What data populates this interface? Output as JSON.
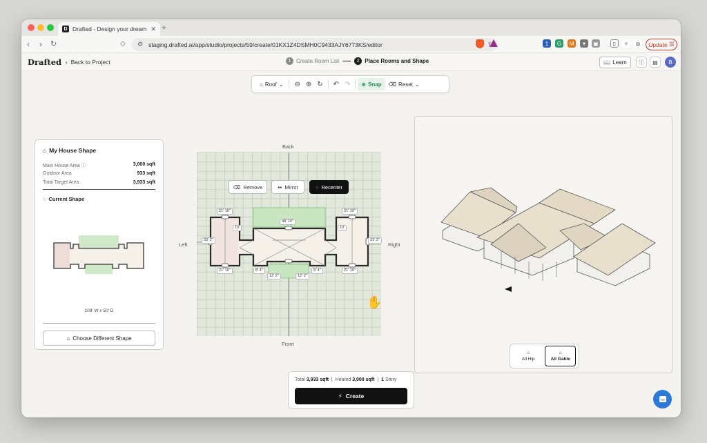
{
  "browser": {
    "tab_title": "Drafted - Design your dream h",
    "favicon_letter": "D",
    "url": "staging.drafted.ai/app/studio/projects/59/create/01KX1Z4DSMH0C9433AJY6773KS/editor",
    "update_label": "Update"
  },
  "header": {
    "logo": "Drafted",
    "back_label": "Back to Project",
    "steps": [
      {
        "num": "1",
        "label": "Create Room List"
      },
      {
        "num": "2",
        "label": "Place Rooms and Shape"
      }
    ],
    "learn_label": "Learn",
    "avatar_initial": "B"
  },
  "toolbar": {
    "roof_label": "Roof",
    "snap_label": "Snap",
    "reset_label": "Reset"
  },
  "left_panel": {
    "title": "My House Shape",
    "rows": [
      {
        "label": "Main House Area",
        "value": "3,000 sqft"
      },
      {
        "label": "Outdoor Area",
        "value": "933 sqft"
      },
      {
        "label": "Total Target Area",
        "value": "3,933 sqft"
      }
    ],
    "current_shape_label": "Current Shape",
    "dimensions": "108' W x 50' D",
    "choose_label": "Choose Different Shape"
  },
  "canvas": {
    "back": "Back",
    "front": "Front",
    "left": "Left",
    "right": "Right",
    "remove_label": "Remove",
    "mirror_label": "Mirror",
    "recenter_label": "Recenter",
    "dims": {
      "top_left": "21' 10\"",
      "top_center": "48' 10\"",
      "top_right": "21' 10\"",
      "bottom_left": "21' 10\"",
      "bottom_right": "21' 10\"",
      "left_side": "33' 2\"",
      "right_side": "33' 2\"",
      "inner_left": "10'",
      "inner_right": "10'",
      "step_left": "8' 4\"",
      "step_right": "8' 4\"",
      "porch_left": "12' 2\"",
      "porch_right": "12' 2\""
    }
  },
  "view3d": {
    "hip_label": "All Hip",
    "gable_label": "All Gable",
    "selected": "All Gable"
  },
  "summary": {
    "total_label": "Total",
    "total_value": "3,933 sqft",
    "heated_label": "Heated",
    "heated_value": "3,000 sqft",
    "story_value": "1",
    "story_label": "Story",
    "create_label": "Create"
  },
  "colors": {
    "accent_green": "#2d8a4e",
    "grid_bg": "#e3e8dc",
    "roof": "#eee6d6",
    "chat": "#2d7ad6"
  }
}
